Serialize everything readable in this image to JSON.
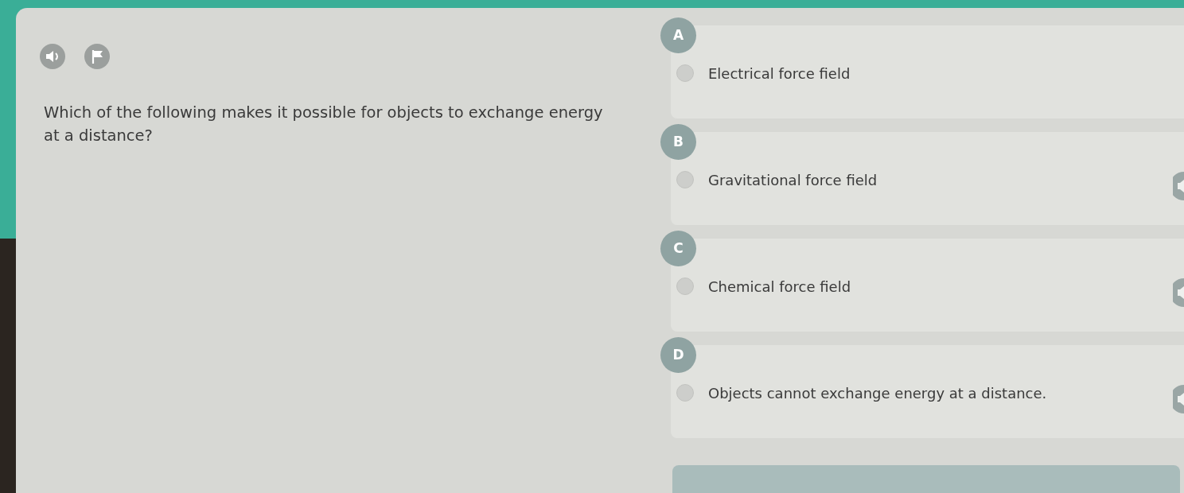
{
  "question": {
    "text": "Which of the following makes it possible for objects to exchange energy at a distance?"
  },
  "options": [
    {
      "letter": "A",
      "text": "Electrical force field",
      "selected": false,
      "speaker": false
    },
    {
      "letter": "B",
      "text": "Gravitational force field",
      "selected": false,
      "speaker": true
    },
    {
      "letter": "C",
      "text": "Chemical force field",
      "selected": false,
      "speaker": true
    },
    {
      "letter": "D",
      "text": "Objects cannot exchange energy at a distance.",
      "selected": false,
      "speaker": true
    }
  ]
}
